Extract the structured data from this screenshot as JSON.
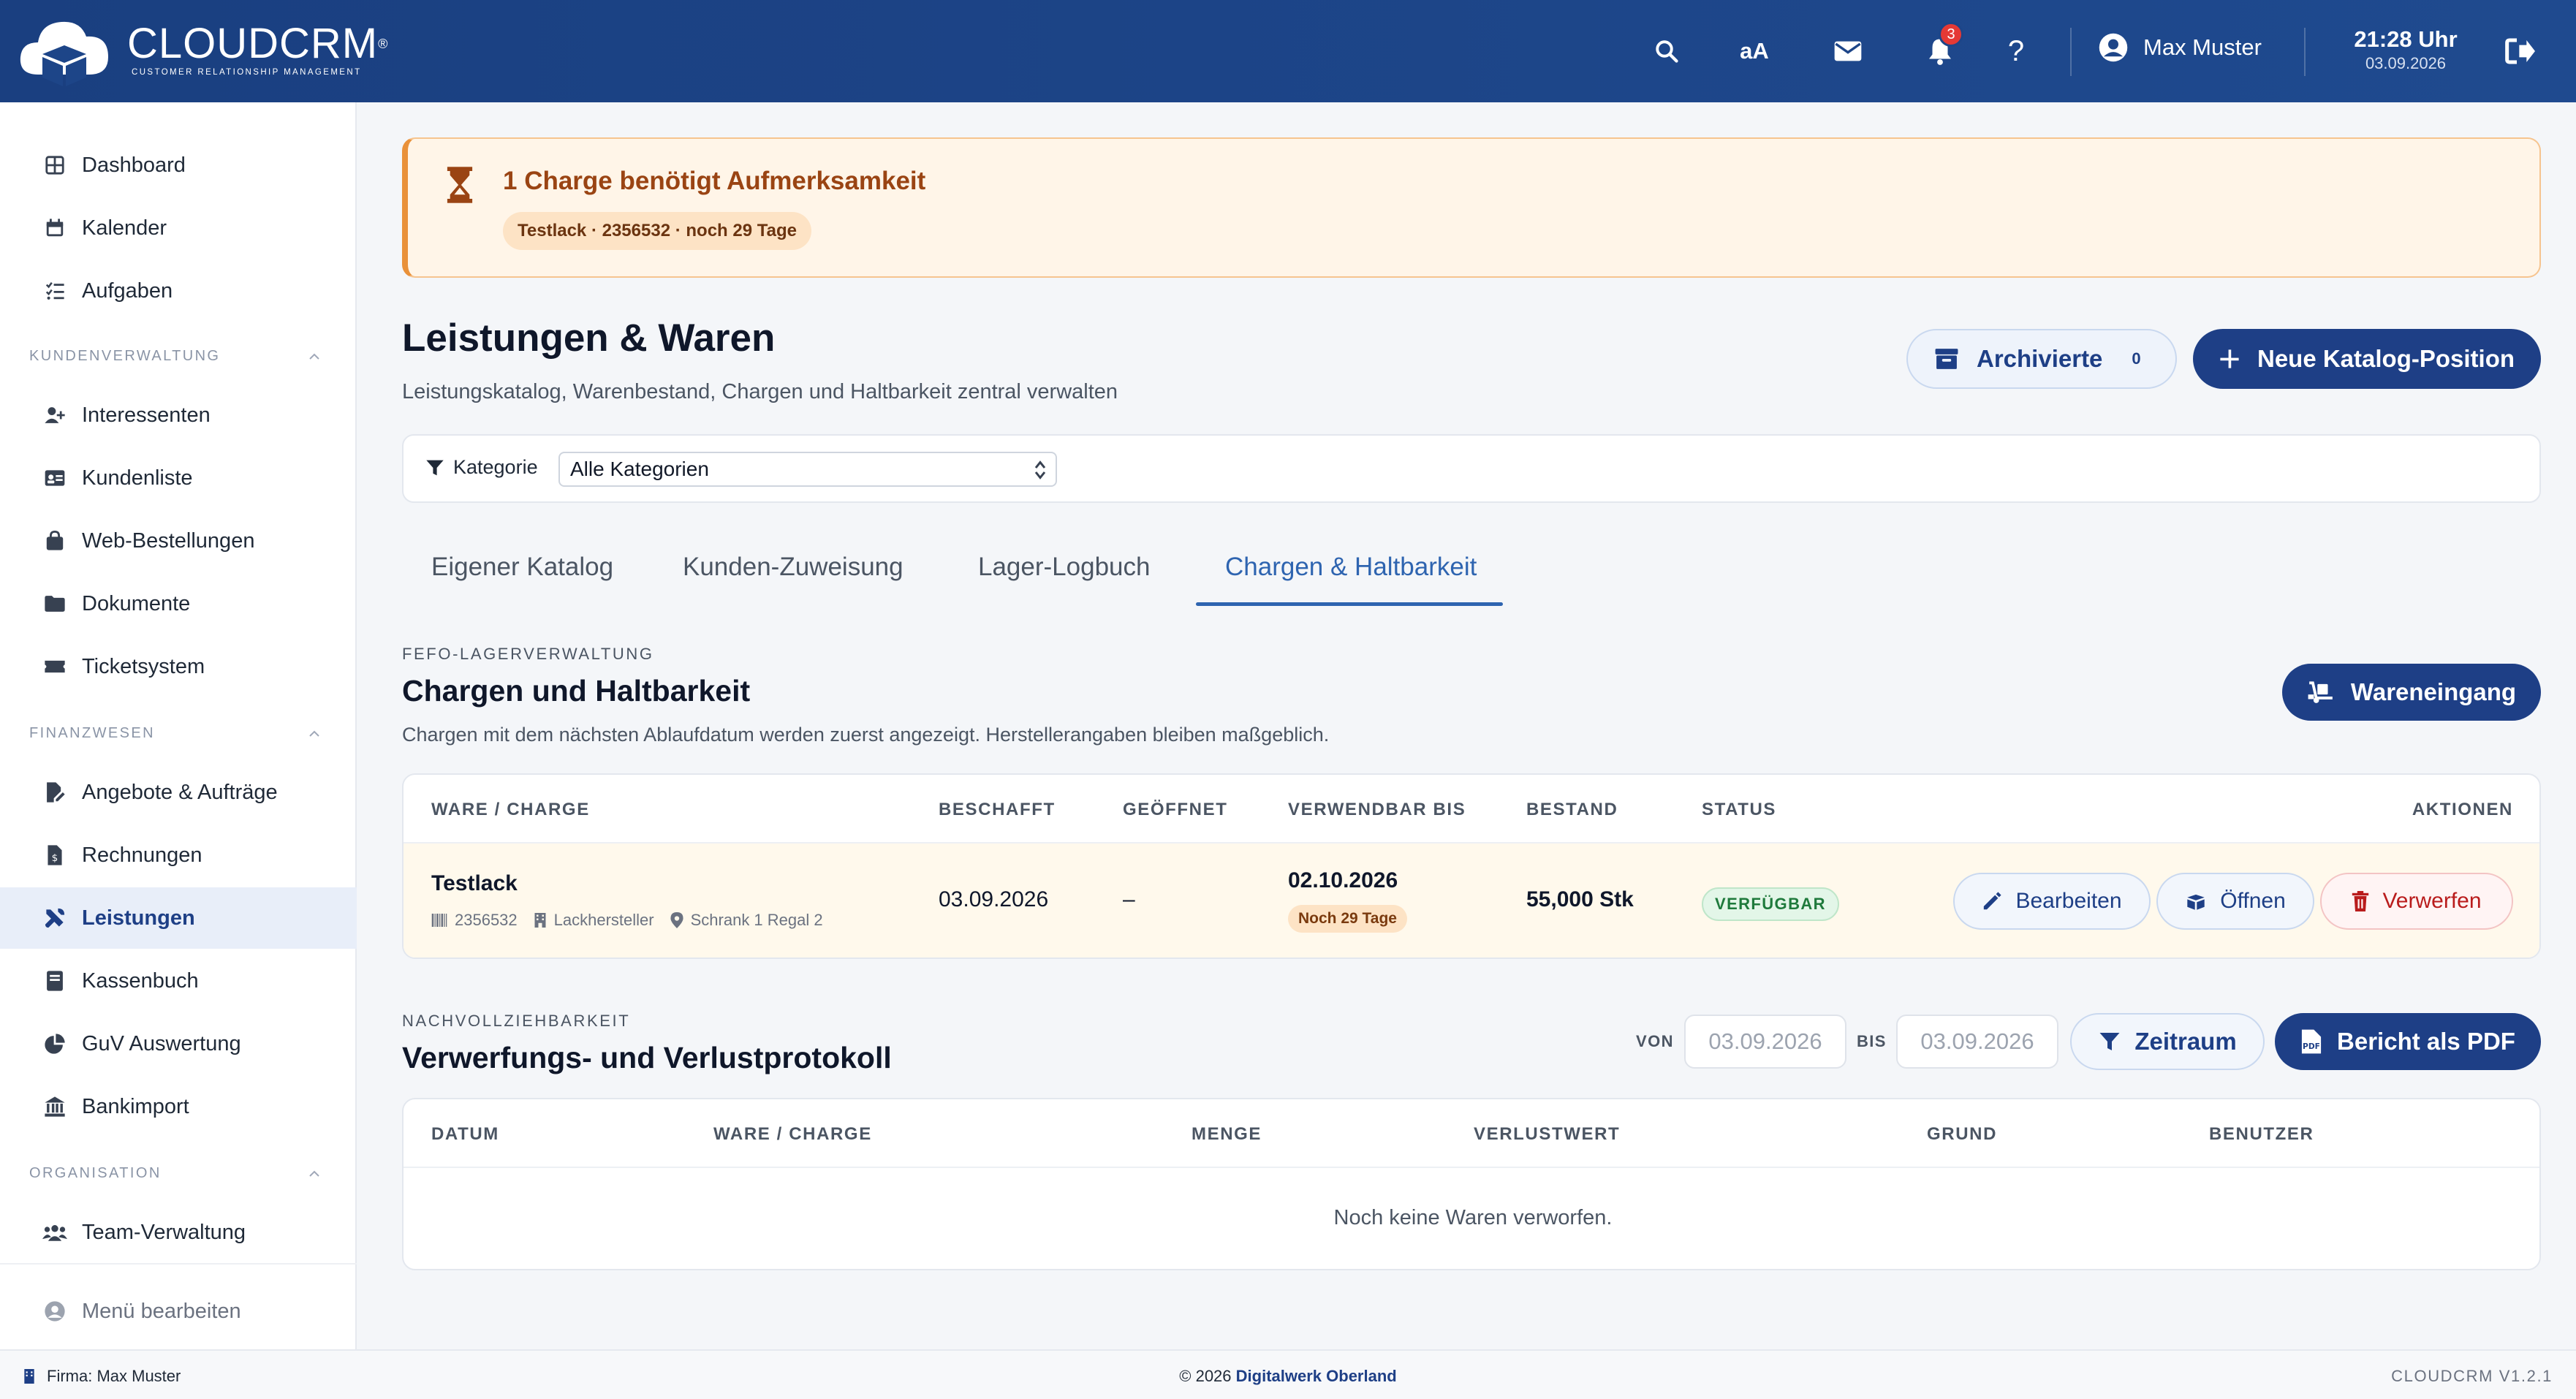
{
  "header": {
    "brand": "CLOUDCRM",
    "brand_reg": "®",
    "brand_sub": "CUSTOMER RELATIONSHIP MANAGEMENT",
    "font_size_toggle": "aA",
    "notifications_count": "3",
    "help": "?",
    "user_name": "Max Muster",
    "time": "21:28 Uhr",
    "date": "03.09.2026"
  },
  "sidebar": {
    "top_items": [
      {
        "label": "Dashboard",
        "icon": "grid-icon"
      },
      {
        "label": "Kalender",
        "icon": "calendar-icon"
      },
      {
        "label": "Aufgaben",
        "icon": "tasks-icon"
      }
    ],
    "sections": [
      {
        "title": "KUNDENVERWALTUNG",
        "items": [
          {
            "label": "Interessenten",
            "icon": "user-plus-icon"
          },
          {
            "label": "Kundenliste",
            "icon": "id-card-icon"
          },
          {
            "label": "Web-Bestellungen",
            "icon": "shopping-bag-icon"
          },
          {
            "label": "Dokumente",
            "icon": "folder-icon"
          },
          {
            "label": "Ticketsystem",
            "icon": "ticket-icon"
          }
        ]
      },
      {
        "title": "FINANZWESEN",
        "items": [
          {
            "label": "Angebote & Aufträge",
            "icon": "file-signature-icon"
          },
          {
            "label": "Rechnungen",
            "icon": "invoice-icon"
          },
          {
            "label": "Leistungen",
            "icon": "tools-icon",
            "active": true
          },
          {
            "label": "Kassenbuch",
            "icon": "book-icon"
          },
          {
            "label": "GuV Auswertung",
            "icon": "pie-chart-icon"
          },
          {
            "label": "Bankimport",
            "icon": "bank-icon"
          }
        ]
      },
      {
        "title": "ORGANISATION",
        "items": [
          {
            "label": "Team-Verwaltung",
            "icon": "team-icon"
          }
        ]
      }
    ],
    "edit_menu": "Menü bearbeiten"
  },
  "alert": {
    "title": "1 Charge benötigt Aufmerksamkeit",
    "chip": "Testlack · 2356532 · noch 29 Tage"
  },
  "page": {
    "title": "Leistungen & Waren",
    "subtitle": "Leistungskatalog, Warenbestand, Chargen und Haltbarkeit zentral verwalten",
    "archived_label": "Archivierte",
    "archived_count": "0",
    "new_button": "Neue Katalog-Position"
  },
  "filter": {
    "label": "Kategorie",
    "selected": "Alle Kategorien"
  },
  "tabs": [
    "Eigener Katalog",
    "Kunden-Zuweisung",
    "Lager-Logbuch",
    "Chargen & Haltbarkeit"
  ],
  "batches": {
    "eyebrow": "FEFO-LAGERVERWALTUNG",
    "title": "Chargen und Haltbarkeit",
    "description": "Chargen mit dem nächsten Ablaufdatum werden zuerst angezeigt. Herstellerangaben bleiben maßgeblich.",
    "incoming_button": "Wareneingang",
    "columns": [
      "WARE / CHARGE",
      "BESCHAFFT",
      "GEÖFFNET",
      "VERWENDBAR BIS",
      "BESTAND",
      "STATUS",
      "AKTIONEN"
    ],
    "rows": [
      {
        "name": "Testlack",
        "batch": "2356532",
        "manufacturer": "Lackhersteller",
        "location": "Schrank 1 Regal 2",
        "procured": "03.09.2026",
        "opened": "–",
        "usable_until": "02.10.2026",
        "remaining": "Noch 29 Tage",
        "stock": "55,000 Stk",
        "status": "VERFÜGBAR",
        "actions": {
          "edit": "Bearbeiten",
          "open": "Öffnen",
          "discard": "Verwerfen"
        }
      }
    ]
  },
  "protocol": {
    "eyebrow": "NACHVOLLZIEHBARKEIT",
    "title": "Verwerfungs- und Verlustprotokoll",
    "from_label": "VON",
    "from_value": "03.09.2026",
    "to_label": "BIS",
    "to_value": "03.09.2026",
    "range_button": "Zeitraum",
    "pdf_button": "Bericht als PDF",
    "columns": [
      "DATUM",
      "WARE / CHARGE",
      "MENGE",
      "VERLUSTWERT",
      "GRUND",
      "BENUTZER"
    ],
    "empty": "Noch keine Waren verworfen."
  },
  "footer": {
    "company": "Firma: Max Muster",
    "copyright": "© 2026",
    "company_link": "Digitalwerk Oberland",
    "version": "CLOUDCRM V1.2.1"
  },
  "colors": {
    "primary": "#1e3f86",
    "header": "#1d4588",
    "warning_bg": "#fff5e8",
    "warning_border": "#e9913a",
    "success": "#1f7a3c",
    "danger": "#b91c1c"
  }
}
